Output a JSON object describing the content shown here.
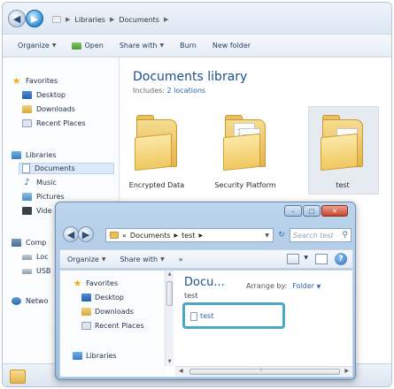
{
  "back_window": {
    "breadcrumb": [
      "Libraries",
      "Documents"
    ],
    "toolbar": {
      "organize": "Organize",
      "open": "Open",
      "share_with": "Share with",
      "burn": "Burn",
      "new_folder": "New folder"
    },
    "nav": {
      "favorites": "Favorites",
      "desktop": "Desktop",
      "downloads": "Downloads",
      "recent_places": "Recent Places",
      "libraries": "Libraries",
      "documents": "Documents",
      "music": "Music",
      "pictures": "Pictures",
      "videos": "Vide",
      "computer": "Comp",
      "local_disk": "Loc",
      "usb": "USB",
      "network": "Netwo"
    },
    "library": {
      "title": "Documents library",
      "includes_label": "Includes:",
      "includes_link": "2 locations"
    },
    "folders": [
      "Encrypted Data",
      "Security Platform",
      "test"
    ]
  },
  "dialog": {
    "caption_buttons": {
      "minimize": "–",
      "maximize": "□",
      "close": "✕"
    },
    "address": {
      "prefix": "«",
      "path": [
        "Documents",
        "test"
      ]
    },
    "search_placeholder": "Search test",
    "toolbar": {
      "organize": "Organize",
      "share_with": "Share with",
      "more": "»"
    },
    "nav": {
      "favorites": "Favorites",
      "desktop": "Desktop",
      "downloads": "Downloads",
      "recent_places": "Recent Places",
      "libraries": "Libraries"
    },
    "content": {
      "title": "Docu...",
      "subtitle": "test",
      "arrange_by_label": "Arrange by:",
      "arrange_by_value": "Folder",
      "file_name": "test"
    }
  }
}
